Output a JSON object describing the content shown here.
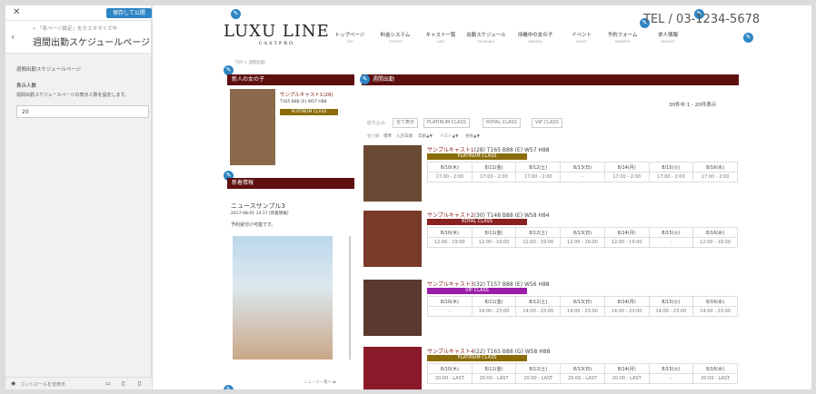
{
  "customizer": {
    "save_label": "保存して公開",
    "breadcrumb": "« 「各ページ設定」をカスタマイズ中",
    "title": "週間出勤スケジュールページ",
    "section_label": "週間出勤スケジュールページ",
    "field_label": "表示人数",
    "field_desc": "週間出勤スケジュールページの表示人数を設定します。",
    "field_value": "20",
    "footer_text": "コントロールを非表示"
  },
  "site": {
    "logo": "LUXU LINE",
    "logo_sub": "CASTPRO",
    "tel": "TEL / 03-1234-5678",
    "nav": [
      {
        "label": "トップページ",
        "sub": "TOP"
      },
      {
        "label": "料金システム",
        "sub": "SYSTEM"
      },
      {
        "label": "キャスト一覧",
        "sub": "CAST"
      },
      {
        "label": "出勤スケジュール",
        "sub": "SCHEDULE"
      },
      {
        "label": "待機中の女の子",
        "sub": "WAITING"
      },
      {
        "label": "イベント",
        "sub": "EVENT"
      },
      {
        "label": "予約フォーム",
        "sub": "RESERVE"
      },
      {
        "label": "求人情報",
        "sub": "RECRUIT"
      }
    ],
    "breadcrumb": "TOP > 週間出勤"
  },
  "sidebar": {
    "new_title": "新人の女の子",
    "new_cast_name": "サンプルキャスト1(28)",
    "new_cast_stats": "T165 B88 (E) W57 H88",
    "new_cast_class": "PLATINUM CLASS",
    "news_title": "新着情報",
    "news_item": "ニュースサンプル3",
    "news_date": "2017-08-01 14:17 [新着情報]",
    "news_text": "予約受付け可能です。",
    "news_more": "ニュース一覧へ ▶"
  },
  "main": {
    "title": "週間出勤",
    "count": "30件中 1 - 20件表示",
    "filter_label": "絞り込み",
    "filters": [
      "全て表示",
      "PLATINUM CLASS",
      "ROYAL CLASS",
      "VIP CLASS"
    ],
    "sort_label": "並び順",
    "sorts": [
      "標準",
      "入店日順",
      "年齢▲▼",
      "バスト▲▼",
      "身長▲▼"
    ],
    "days": [
      "8/10(木)",
      "8/11(金)",
      "8/12(土)",
      "8/13(日)",
      "8/14(月)",
      "8/15(火)",
      "8/16(水)"
    ],
    "casts": [
      {
        "name": "サンプルキャスト1",
        "age": "(28)",
        "stats": "T165 B88 (E) W57 H88",
        "class": "PLATINUM CLASS",
        "color": "#8a6d0a",
        "times": [
          "17:00 - 2:00",
          "17:00 - 2:00",
          "17:00 - 2:00",
          "-",
          "17:00 - 2:00",
          "17:00 - 2:00",
          "17:00 - 2:00"
        ]
      },
      {
        "name": "サンプルキャスト2",
        "age": "(30)",
        "stats": "T148 B88 (E) W58 H84",
        "class": "ROYAL CLASS",
        "color": "#8a2222",
        "times": [
          "12:00 - 19:00",
          "12:00 - 19:00",
          "12:00 - 19:00",
          "12:00 - 19:00",
          "12:00 - 19:00",
          "-",
          "12:00 - 19:00"
        ]
      },
      {
        "name": "サンプルキャスト3",
        "age": "(32)",
        "stats": "T157 B88 (E) W56 H88",
        "class": "VIP CLASS",
        "color": "#9b1eaa",
        "times": [
          "-",
          "14:00 - 23:00",
          "14:00 - 23:00",
          "14:00 - 23:00",
          "14:00 - 23:00",
          "14:00 - 23:00",
          "14:00 - 23:00"
        ]
      },
      {
        "name": "サンプルキャスト4",
        "age": "(22)",
        "stats": "T165 B88 (G) W58 H88",
        "class": "PLATINUM CLASS",
        "color": "#8a6d0a",
        "times": [
          "20:00 - LAST",
          "20:00 - LAST",
          "20:00 - LAST",
          "20:00 - LAST",
          "20:00 - LAST",
          "-",
          "20:00 - LAST"
        ]
      }
    ]
  },
  "icons": {
    "edit": "pencil-icon"
  }
}
